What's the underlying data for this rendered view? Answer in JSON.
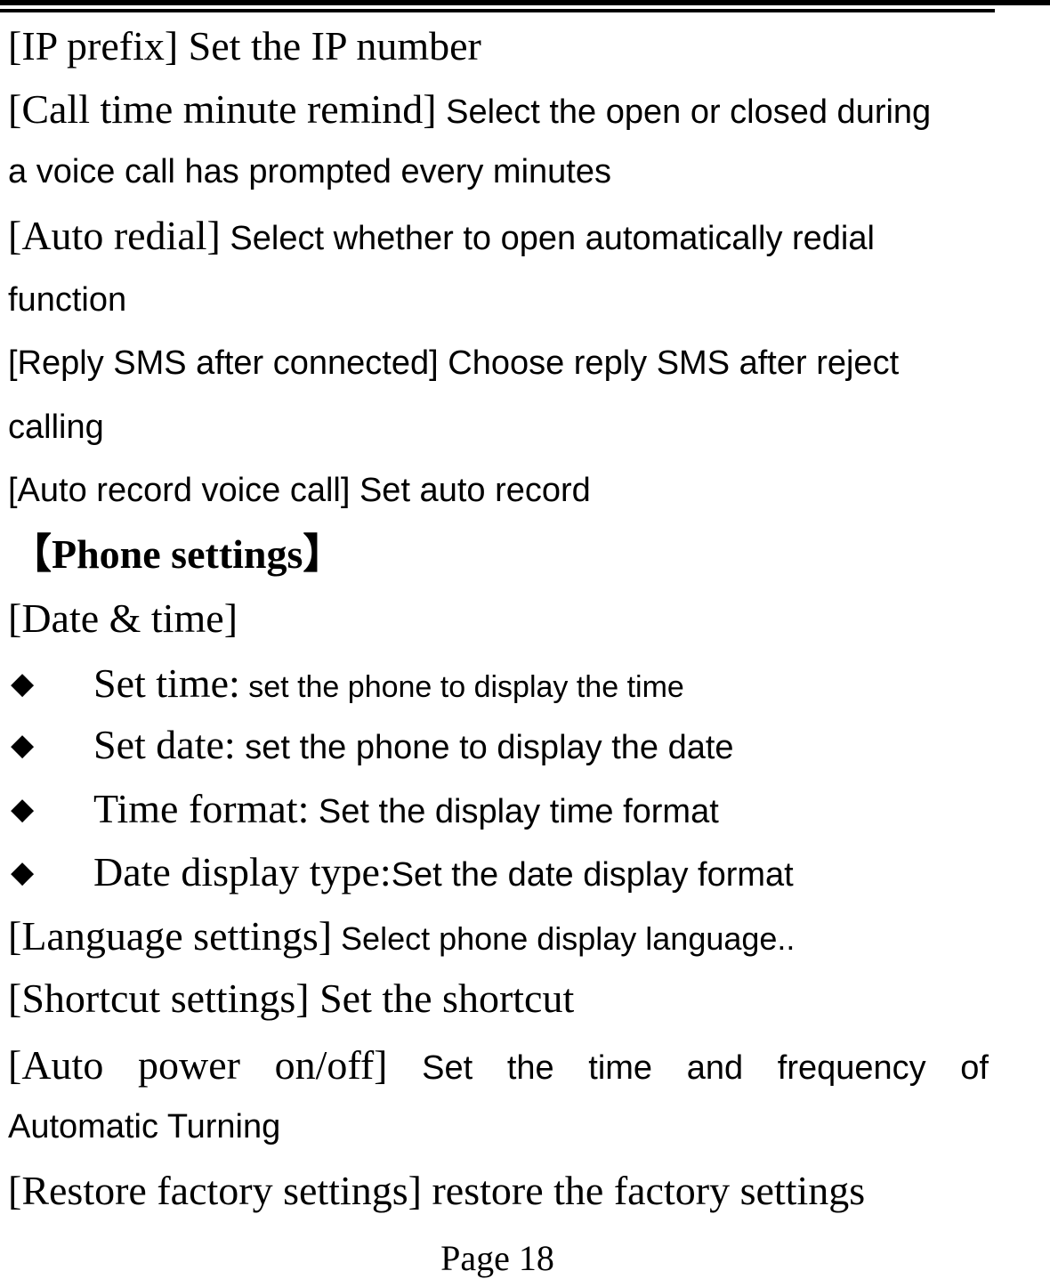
{
  "document": {
    "call_settings": [
      {
        "label": "[IP prefix]",
        "desc": " Set the IP number"
      },
      {
        "label": "[Call time minute remind]",
        "desc": " Select the open or closed during",
        "cont": "a voice call has prompted every minutes"
      },
      {
        "label": "[Auto redial]",
        "desc": " Select whether to open automatically redial",
        "cont": "function"
      },
      {
        "label": "[Reply SMS after connected]",
        "desc": " Choose reply SMS after reject",
        "cont": "calling"
      },
      {
        "label": "[Auto record voice call]",
        "desc": " Set auto record"
      }
    ],
    "section_heading": "【Phone settings】",
    "date_time": {
      "label": "[Date & time]",
      "bullet_glyph": "◆",
      "items": [
        {
          "term": "Set time:",
          "desc": " set the phone to display the time"
        },
        {
          "term": "Set date:",
          "desc": " set the phone to display the date"
        },
        {
          "term": "Time format:",
          "desc": " Set the display time format"
        },
        {
          "term": "Date display type:",
          "desc": "Set the date display format"
        }
      ]
    },
    "language": {
      "label": "[Language settings]",
      "desc": " Select phone display language.."
    },
    "shortcut": {
      "label": "[Shortcut settings]",
      "desc": " Set the shortcut"
    },
    "auto_power": {
      "words_serif": [
        "[Auto",
        "power",
        "on/off]"
      ],
      "words_sans": [
        "Set",
        "the",
        "time",
        "and",
        "frequency",
        "of"
      ],
      "cont": "Automatic Turning"
    },
    "restore": {
      "label": "[Restore factory settings]",
      "desc": " restore the factory settings"
    },
    "footer": "Page 18"
  }
}
